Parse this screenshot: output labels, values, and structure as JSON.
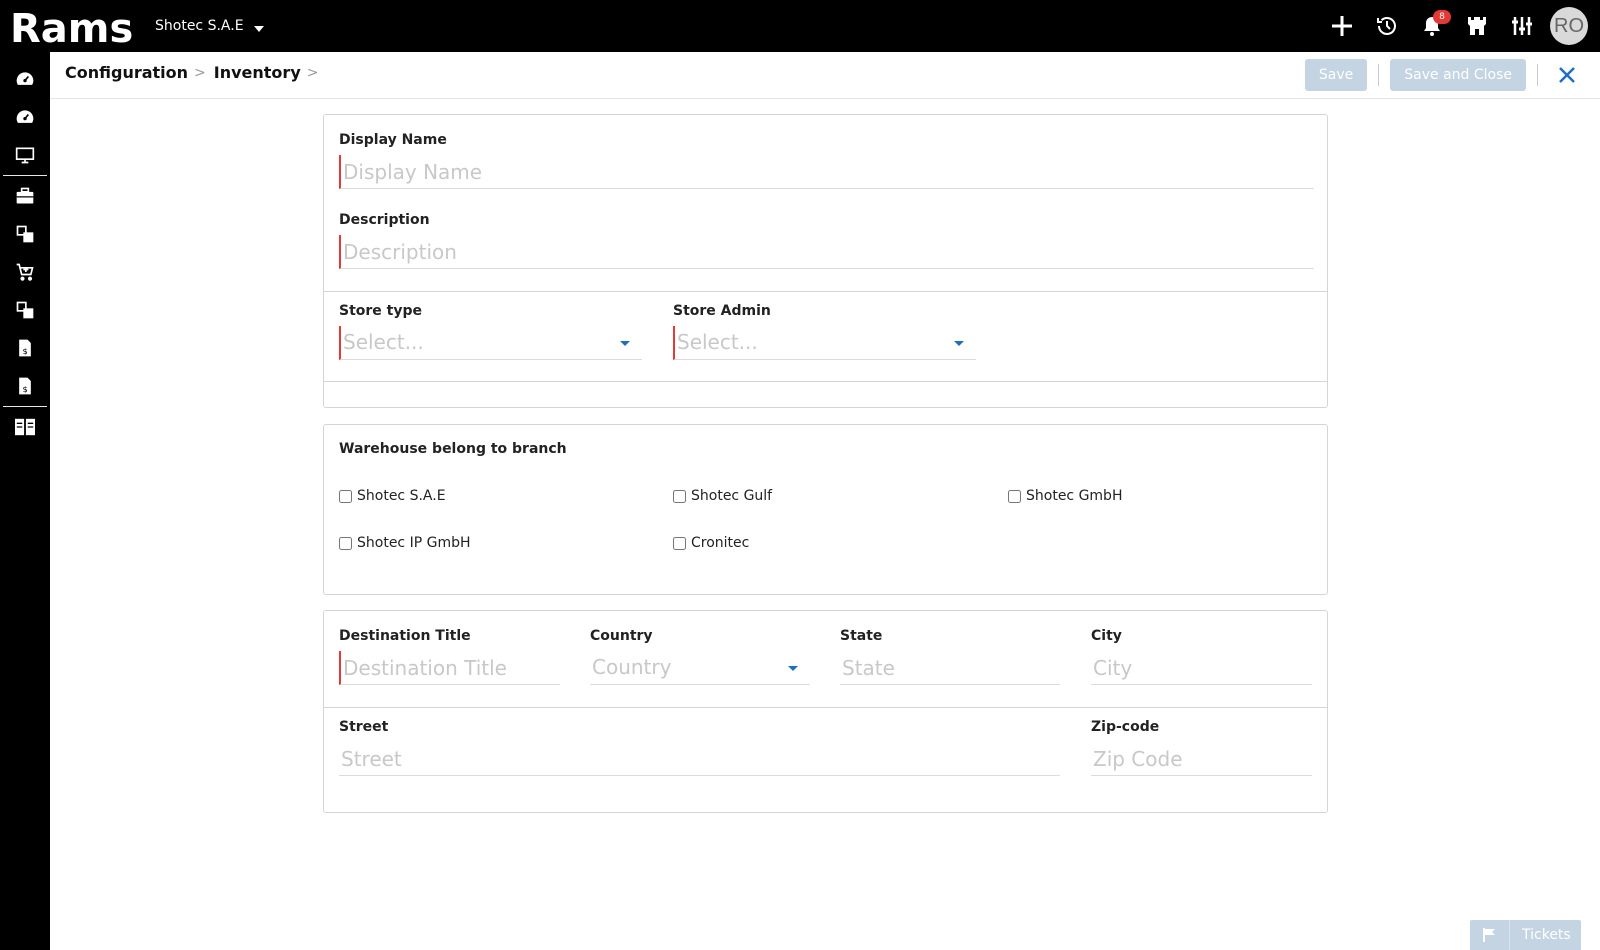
{
  "topbar": {
    "logo_text": "Rams",
    "company": "Shotec S.A.E",
    "notification_count": "8",
    "user_initials": "RO",
    "icons": [
      "plus-icon",
      "history-icon",
      "bell-icon",
      "castle-icon",
      "sliders-icon"
    ]
  },
  "sidebar": {
    "items": [
      "dashboard-icon",
      "dashboard-icon",
      "monitor-icon",
      "briefcase-icon",
      "modules-icon",
      "cart-icon",
      "modules-icon",
      "invoice-icon",
      "invoice-icon",
      "layout-icon"
    ]
  },
  "header": {
    "breadcrumb": [
      "Configuration",
      "Inventory"
    ],
    "save_label": "Save",
    "save_close_label": "Save and Close"
  },
  "general": {
    "display_name_label": "Display Name",
    "display_name_placeholder": "Display Name",
    "description_label": "Description",
    "description_placeholder": "Description",
    "store_type_label": "Store type",
    "store_type_placeholder": "Select...",
    "store_admin_label": "Store Admin",
    "store_admin_placeholder": "Select..."
  },
  "branches": {
    "title": "Warehouse belong to branch",
    "options": [
      "Shotec S.A.E",
      "Shotec Gulf",
      "Shotec GmbH",
      "Shotec IP GmbH",
      "Cronitec"
    ]
  },
  "address": {
    "destination_label": "Destination Title",
    "destination_placeholder": "Destination Title",
    "country_label": "Country",
    "country_placeholder": "Country",
    "state_label": "State",
    "state_placeholder": "State",
    "city_label": "City",
    "city_placeholder": "City",
    "street_label": "Street",
    "street_placeholder": "Street",
    "zip_label": "Zip-code",
    "zip_placeholder": "Zip Code"
  },
  "footer": {
    "tickets_label": "Tickets"
  },
  "colors": {
    "accent": "#1f6fbf",
    "required": "#e53935",
    "disabled_button": "#c5d4e3"
  }
}
